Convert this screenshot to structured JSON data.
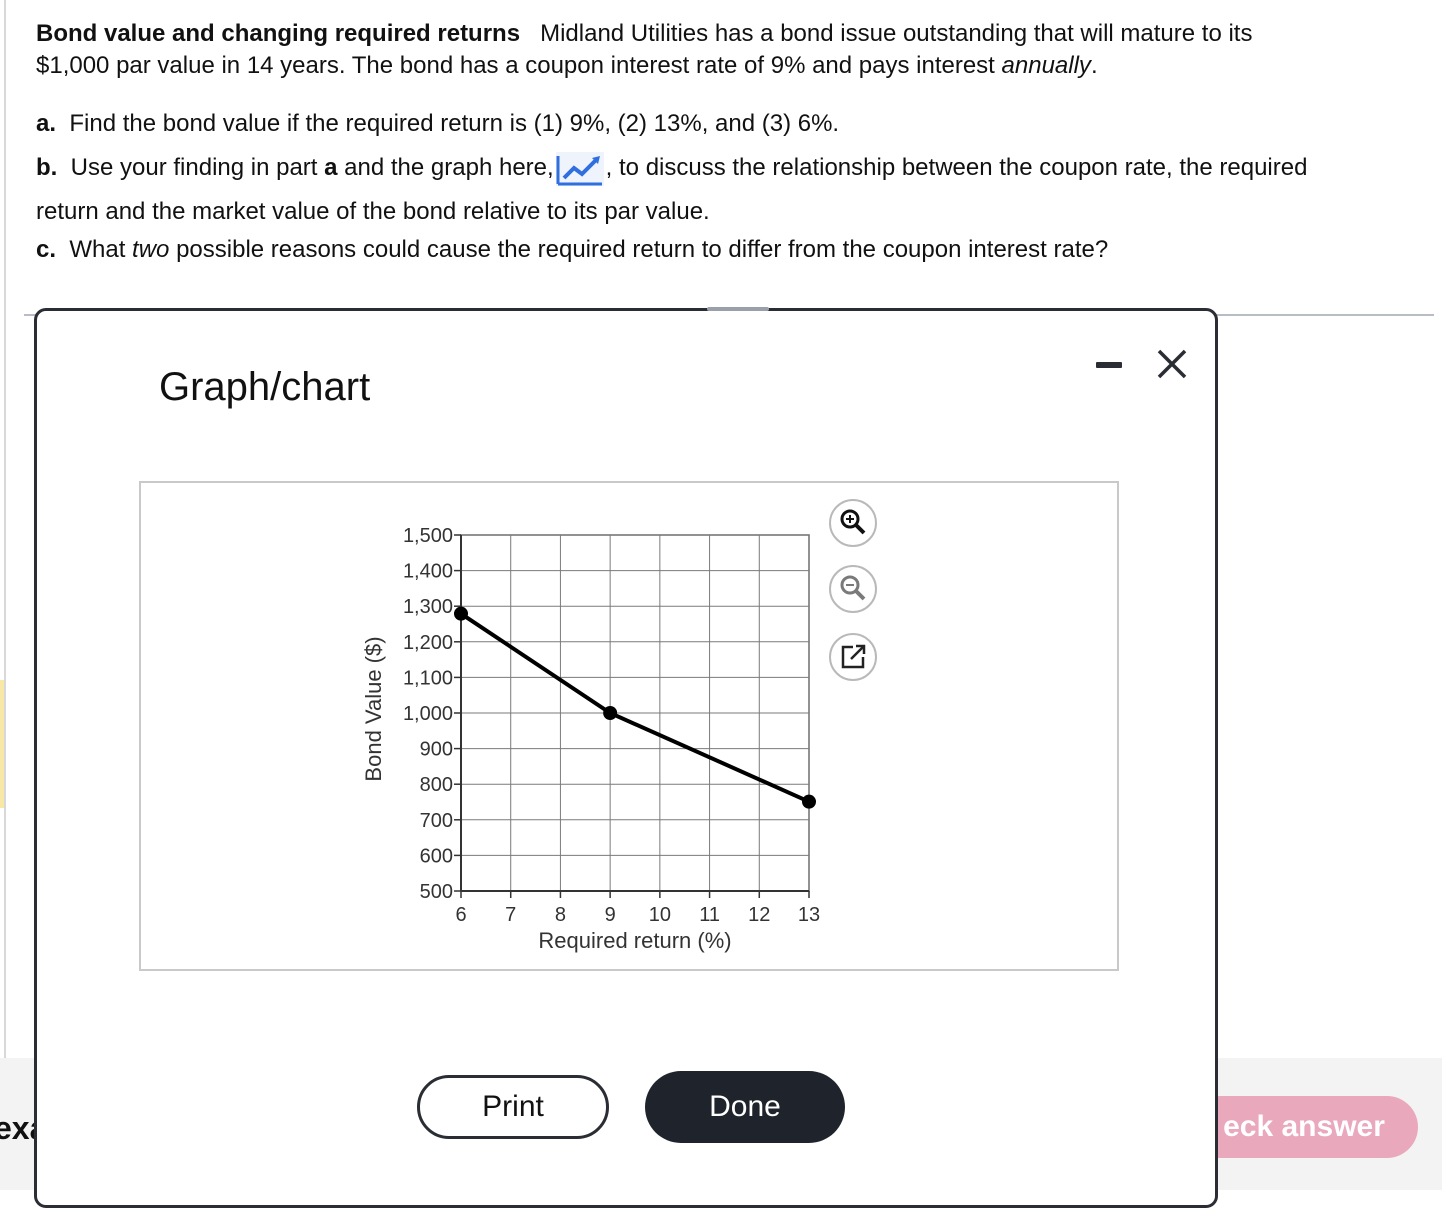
{
  "question": {
    "title": "Bond value and changing required returns",
    "intro_line1": "Midland Utilities has a bond issue outstanding that will mature to its",
    "intro_line2": "$1,000 par value in 14 years.  The bond has a coupon interest rate of 9% and pays interest",
    "intro_emph": "annually",
    "intro_end": ".",
    "a_label": "a.",
    "a_text": "Find the bond value if the required return is (1) 9%, (2) 13%, and (3) 6%.",
    "b_label": "b.",
    "b_text1": "Use your finding in part",
    "b_bold": "a",
    "b_text2": "and the graph here,",
    "b_text3": ", to discuss the relationship between the coupon rate, the required",
    "b_text4": "return and the market value of the bond relative to its par value.",
    "c_label": "c.",
    "c_text1": "What",
    "c_emph": "two",
    "c_text2": "possible reasons could cause the required return to differ from the coupon interest rate?"
  },
  "modal": {
    "title": "Graph/chart",
    "print_label": "Print",
    "done_label": "Done"
  },
  "background": {
    "partial_text": "exa",
    "check_answer_label": "eck answer"
  },
  "icons": {
    "chart_link": "line-chart-icon",
    "zoom_in": "zoom-in-icon",
    "zoom_out": "zoom-out-icon",
    "popout": "popout-icon",
    "minimize": "minimize-icon",
    "close": "close-icon"
  },
  "colors": {
    "accent_dark": "#1f232b",
    "check_answer_bg": "#e9a8bc",
    "chart_icon_blue": "#2f6fde"
  },
  "chart_data": {
    "type": "line",
    "title": "",
    "xlabel": "Required return (%)",
    "ylabel": "Bond Value ($)",
    "xlim": [
      6,
      13
    ],
    "ylim": [
      500,
      1500
    ],
    "x_ticks": [
      6,
      7,
      8,
      9,
      10,
      11,
      12,
      13
    ],
    "y_ticks": [
      500,
      600,
      700,
      800,
      900,
      1000,
      1100,
      1200,
      1300,
      1400,
      1500
    ],
    "y_tick_labels": [
      "500",
      "600",
      "700",
      "800",
      "900",
      "1,000",
      "1,100",
      "1,200",
      "1,300",
      "1,400",
      "1,500"
    ],
    "grid": true,
    "series": [
      {
        "x": [
          6,
          9,
          13
        ],
        "y": [
          1279,
          1000,
          751
        ]
      }
    ]
  }
}
